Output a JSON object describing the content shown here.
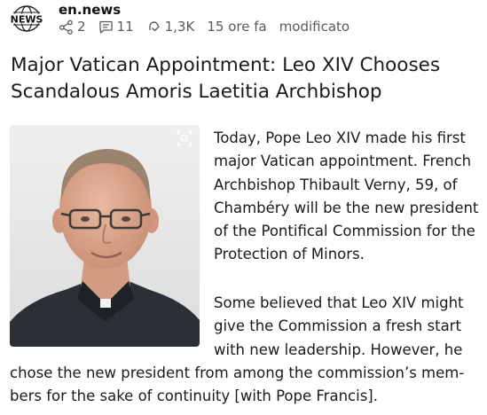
{
  "source": {
    "logo_text": "NEWS",
    "name": "en.news"
  },
  "meta": {
    "shares": "2",
    "comments": "11",
    "views": "1,3K",
    "time_ago": "15 ore fa",
    "modified": "modificato"
  },
  "article": {
    "title_line1": "Major Vatican Appointment: Leo XIV Chooses",
    "title_line2": "Scandalous Amoris Laetitia Archbishop",
    "p1_lines": [
      "Today, Pope Leo XIV made his first",
      "major Vatican appointment. French",
      "Archbishop Thibault Verny, 59, of",
      "Chambéry will be the new president",
      "of the Pontifical Commission for the",
      "Protection of Minors."
    ],
    "p2_lines_top": [
      "Some believed that Leo XIV might",
      "give the Commission a fresh start",
      "with new leadership. However, he"
    ],
    "p2_lines_bottom": [
      "chose the new president from among the commission’s mem-",
      "bers for the sake of continuity [with Pope Francis]."
    ]
  },
  "icons": {
    "logo": "globe-news-logo",
    "shares": "share-icon",
    "comments": "comment-icon",
    "views": "views-icon",
    "zoom": "visual-search-icon"
  }
}
